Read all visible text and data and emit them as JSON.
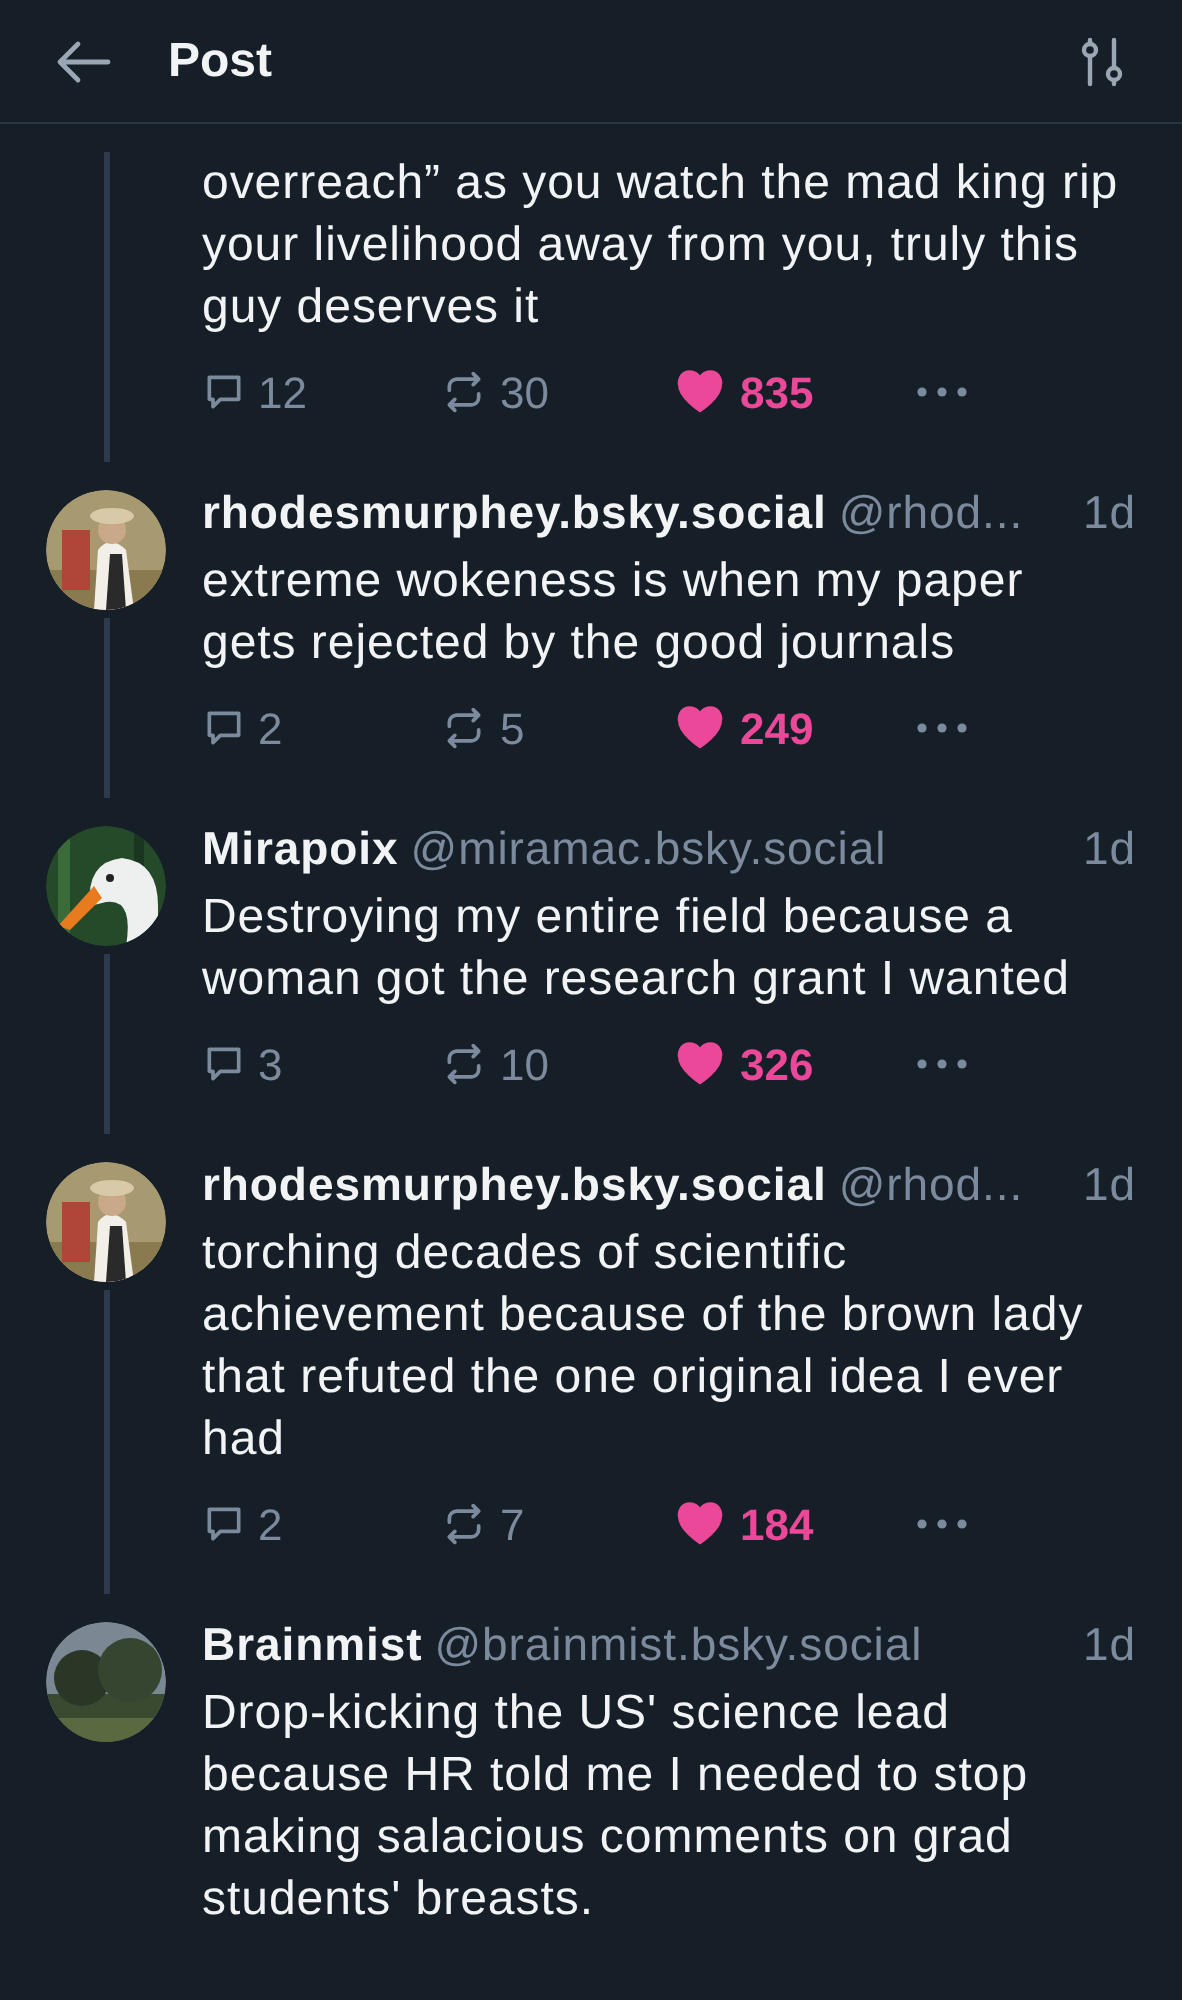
{
  "header": {
    "title": "Post"
  },
  "posts": [
    {
      "text": "overreach” as you watch the mad king rip your livelihood away from you, truly this guy deserves it",
      "replies": "12",
      "reposts": "30",
      "likes": "835",
      "liked": true
    },
    {
      "author": {
        "name": "rhodesmurphey.bsky.social",
        "handle": "@rhod..."
      },
      "time": "1d",
      "text": "extreme wokeness is when my paper gets rejected by the good journals",
      "replies": "2",
      "reposts": "5",
      "likes": "249",
      "liked": true
    },
    {
      "author": {
        "name": "Mirapoix",
        "handle": "@miramac.bsky.social"
      },
      "time": "1d",
      "text": "Destroying my entire field because a woman got the research grant I wanted",
      "replies": "3",
      "reposts": "10",
      "likes": "326",
      "liked": true
    },
    {
      "author": {
        "name": "rhodesmurphey.bsky.social",
        "handle": "@rhod..."
      },
      "time": "1d",
      "text": "torching decades of scientific achievement because of the brown lady that refuted the one original idea I ever had",
      "replies": "2",
      "reposts": "7",
      "likes": "184",
      "liked": true
    },
    {
      "author": {
        "name": "Brainmist",
        "handle": "@brainmist.bsky.social"
      },
      "time": "1d",
      "text": "Drop-kicking the US' science lead because HR told me I needed to stop making salacious comments on grad students' breasts."
    }
  ]
}
